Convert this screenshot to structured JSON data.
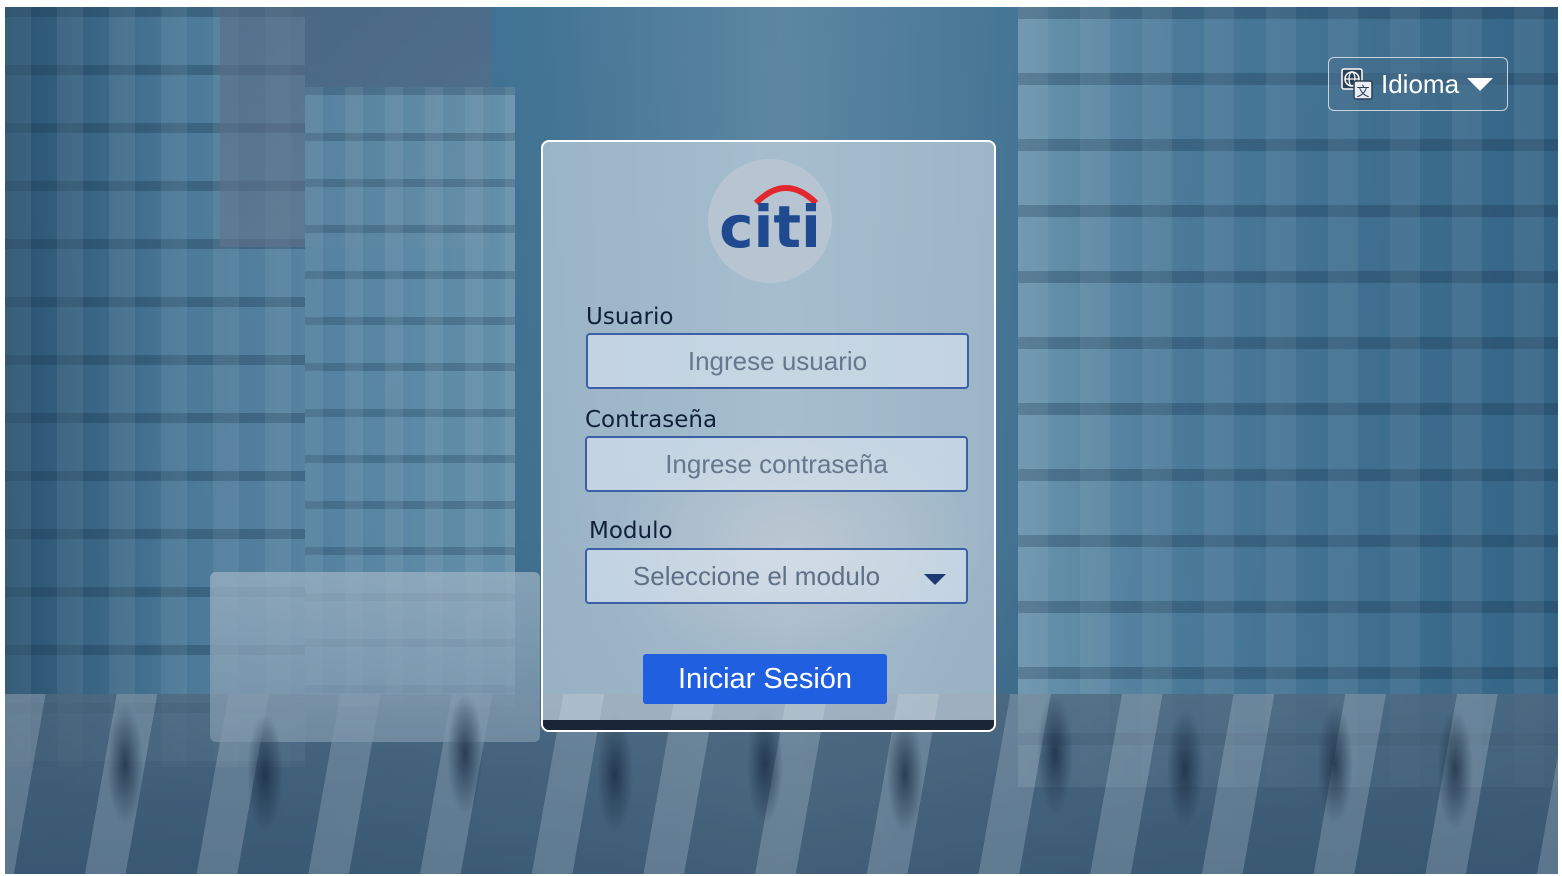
{
  "language_button": {
    "label": "Idioma",
    "icon": "translate-icon"
  },
  "logo": {
    "text": "citi",
    "text_color": "#1f4a8f",
    "arc_color": "#e3272f"
  },
  "form": {
    "user": {
      "label": "Usuario",
      "placeholder": "Ingrese usuario"
    },
    "password": {
      "label": "Contraseña",
      "placeholder": "Ingrese contraseña"
    },
    "module": {
      "label": "Modulo",
      "selected": "Seleccione el modulo"
    },
    "submit_label": "Iniciar Sesión"
  },
  "colors": {
    "primary_button": "#1f5fe0",
    "input_border": "#3c5fa6"
  }
}
